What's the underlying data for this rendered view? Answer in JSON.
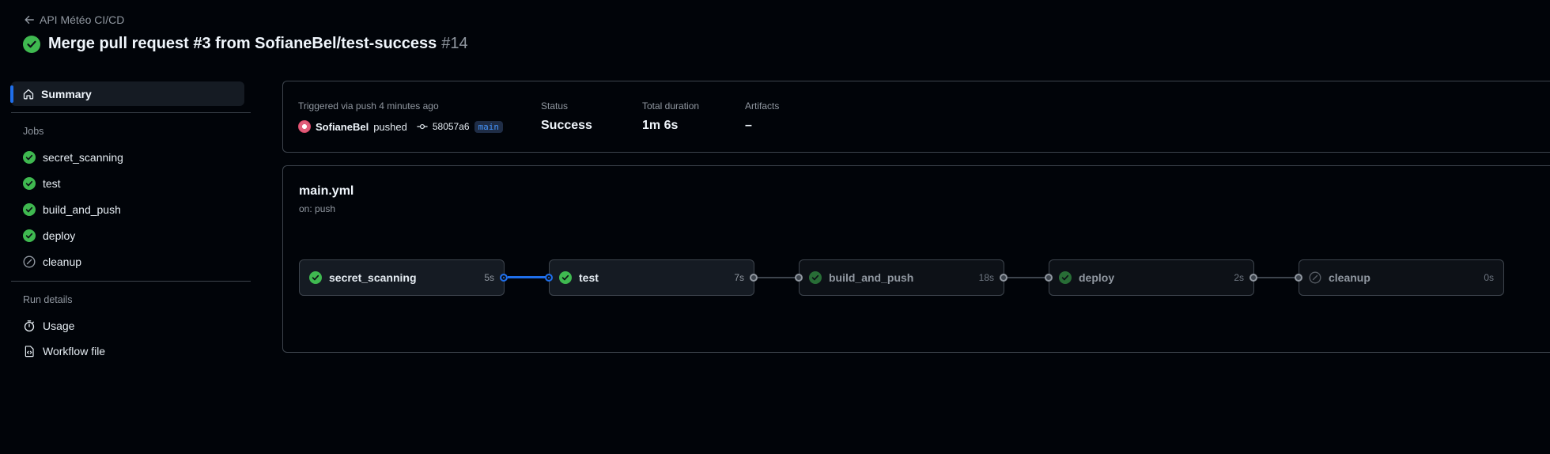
{
  "header": {
    "back_label": "API Météo CI/CD",
    "title": "Merge pull request #3 from SofianeBel/test-success",
    "run_number": "#14"
  },
  "sidebar": {
    "summary_label": "Summary",
    "jobs_heading": "Jobs",
    "jobs": [
      {
        "label": "secret_scanning",
        "status": "success"
      },
      {
        "label": "test",
        "status": "success"
      },
      {
        "label": "build_and_push",
        "status": "success"
      },
      {
        "label": "deploy",
        "status": "success"
      },
      {
        "label": "cleanup",
        "status": "skipped"
      }
    ],
    "run_details_heading": "Run details",
    "usage_label": "Usage",
    "workflow_file_label": "Workflow file"
  },
  "summary": {
    "trigger_text": "Triggered via push 4 minutes ago",
    "user": "SofianeBel",
    "action": "pushed",
    "commit_sha": "58057a6",
    "branch": "main",
    "status_label": "Status",
    "status_value": "Success",
    "duration_label": "Total duration",
    "duration_value": "1m 6s",
    "artifacts_label": "Artifacts",
    "artifacts_value": "–"
  },
  "workflow": {
    "file_name": "main.yml",
    "trigger": "on: push",
    "jobs": [
      {
        "name": "secret_scanning",
        "duration": "5s",
        "status": "success"
      },
      {
        "name": "test",
        "duration": "7s",
        "status": "success"
      },
      {
        "name": "build_and_push",
        "duration": "18s",
        "status": "success"
      },
      {
        "name": "deploy",
        "duration": "2s",
        "status": "success"
      },
      {
        "name": "cleanup",
        "duration": "0s",
        "status": "skipped"
      }
    ]
  },
  "colors": {
    "success": "#3fb950",
    "accent": "#1f6feb",
    "background": "#010409"
  }
}
